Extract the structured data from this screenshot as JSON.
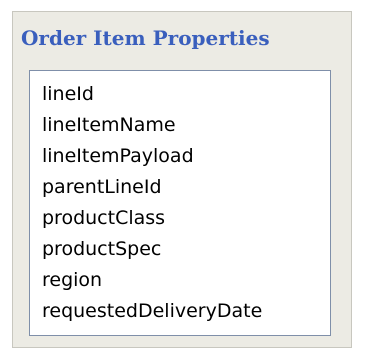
{
  "panel": {
    "title": "Order Item Properties",
    "items": [
      "lineId",
      "lineItemName",
      "lineItemPayload",
      "parentLineId",
      "productClass",
      "productSpec",
      "region",
      "requestedDeliveryDate"
    ]
  },
  "colors": {
    "title": "#3a5fbd",
    "panel_background": "#ecebe4",
    "list_border": "#7f8fa9"
  }
}
